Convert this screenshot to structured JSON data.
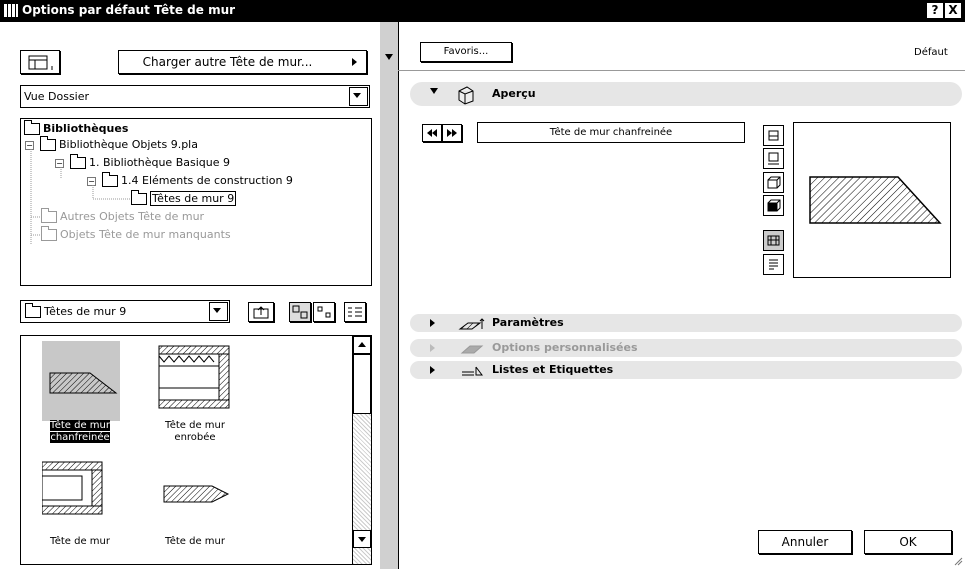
{
  "window": {
    "title": "Options par défaut Tête de mur",
    "help_label": "?",
    "close_label": "X"
  },
  "left": {
    "load_button": "Charger autre Tête de mur...",
    "view_select": "Vue Dossier",
    "tree": [
      {
        "label": "Bibliothèques",
        "bold": true
      },
      {
        "label": "Bibliothèque Objets 9.pla"
      },
      {
        "label": "1. Bibliothèque Basique 9"
      },
      {
        "label": "1.4 Eléments de construction 9"
      },
      {
        "label": "Têtes de mur 9"
      },
      {
        "label": "Autres Objets Tête de mur"
      },
      {
        "label": "Objets Tête de mur manquants"
      }
    ],
    "folder_select": "Têtes de mur 9",
    "objects": [
      {
        "line1": "Tête de mur",
        "line2": "chanfreinée",
        "selected": true
      },
      {
        "line1": "Tête de mur",
        "line2": "enrobée"
      },
      {
        "line1": "Tête de mur",
        "line2": ""
      },
      {
        "line1": "Tête de mur",
        "line2": ""
      }
    ]
  },
  "right": {
    "favorites_button": "Favoris...",
    "default_label": "Défaut",
    "preview_section": "Aperçu",
    "object_name": "Tête de mur chanfreinée",
    "sections": [
      {
        "label": "Paramètres",
        "disabled": false
      },
      {
        "label": "Options personnalisées",
        "disabled": true
      },
      {
        "label": "Listes et Etiquettes",
        "disabled": false
      }
    ],
    "cancel_button": "Annuler",
    "ok_button": "OK"
  },
  "icons": [
    "library-view-icon",
    "nav-prev-icon",
    "nav-next-icon",
    "preview-2d-icon",
    "preview-plan-icon",
    "preview-3d-icon",
    "preview-shaded-icon",
    "preview-elevation-icon",
    "preview-list-icon",
    "folder-up-icon",
    "large-icons-view",
    "small-icons-view",
    "list-view-icon"
  ]
}
